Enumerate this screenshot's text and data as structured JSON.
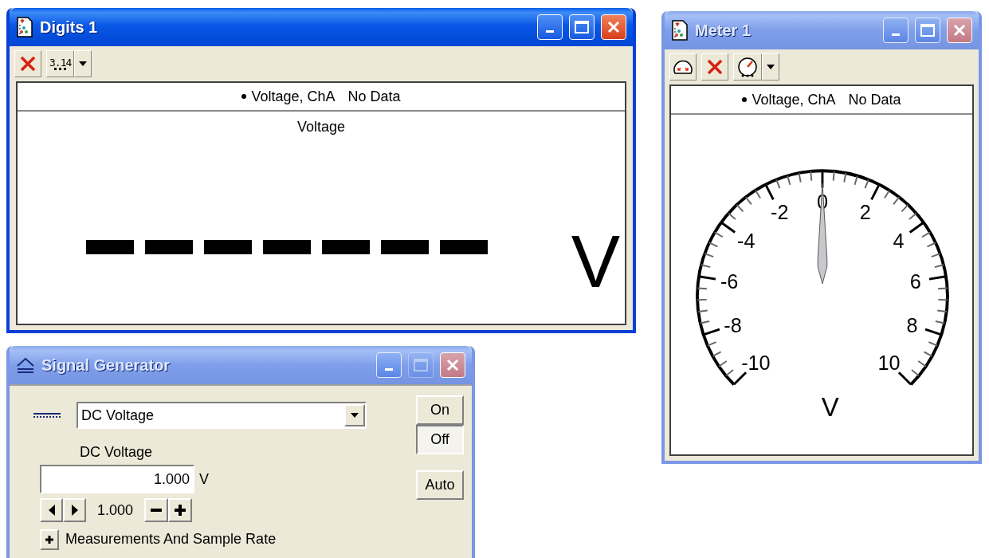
{
  "windows": [
    {
      "kind": "digits",
      "title": "Digits 1",
      "active": true,
      "maximize_disabled": false,
      "toolbar": [
        {
          "kind": "delete"
        },
        {
          "kind": "format",
          "label": "3.14",
          "dropdown": true
        }
      ],
      "legend": {
        "name": "Voltage, ChA",
        "status": "No Data"
      },
      "label": "Voltage",
      "unit": "V"
    },
    {
      "kind": "meter",
      "title": "Meter 1",
      "active": false,
      "maximize_disabled": false,
      "toolbar": [
        {
          "kind": "zoom"
        },
        {
          "kind": "delete"
        },
        {
          "kind": "gauge",
          "dropdown": true
        }
      ],
      "legend": {
        "name": "Voltage, ChA",
        "status": "No Data"
      },
      "scale": [
        "-10",
        "-8",
        "-6",
        "-4",
        "-2",
        "0",
        "2",
        "4",
        "6",
        "8",
        "10"
      ],
      "unit": "V"
    },
    {
      "kind": "signal",
      "title": "Signal Generator",
      "active": false,
      "maximize_disabled": true,
      "waveform": "DC Voltage",
      "field_label": "DC Voltage",
      "value": "1.000",
      "unit": "V",
      "step": "1.000",
      "expander": {
        "label": "Measurements And Sample Rate",
        "expanded": false
      },
      "buttons": [
        {
          "label": "On",
          "selected": false
        },
        {
          "label": "Off",
          "selected": true
        },
        {
          "label": "Auto",
          "selected": false
        }
      ]
    }
  ]
}
